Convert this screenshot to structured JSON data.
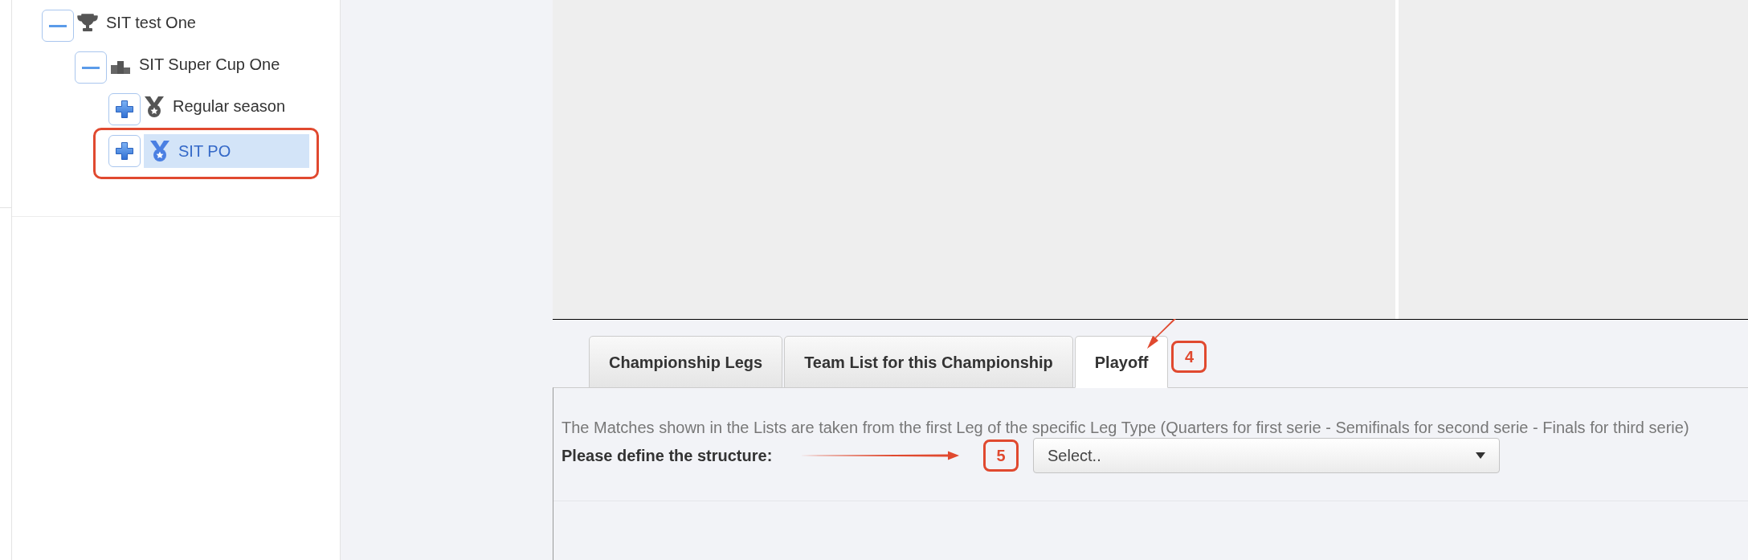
{
  "tree": [
    {
      "label": "SIT test One",
      "expanded": true,
      "selected": false,
      "children": [
        {
          "label": "SIT Super Cup One",
          "expanded": true,
          "selected": false,
          "children": [
            {
              "label": "Regular season",
              "expanded": false,
              "selected": false
            },
            {
              "label": "SIT PO",
              "expanded": false,
              "selected": true
            }
          ]
        }
      ]
    }
  ],
  "tabs": [
    {
      "label": "Championship Legs",
      "selected": false
    },
    {
      "label": "Team List for this Championship",
      "selected": false
    },
    {
      "label": "Playoff",
      "selected": true
    }
  ],
  "playoff_panel": {
    "note": "The Matches shown in the Lists are taken from the first Leg of the specific Leg Type (Quarters for first serie - Semifinals for second serie - Finals for third serie)",
    "structure_label": "Please define the structure:",
    "structure_select": {
      "value": "Select.."
    }
  },
  "callouts": [
    {
      "label": "4"
    },
    {
      "label": "5"
    }
  ]
}
